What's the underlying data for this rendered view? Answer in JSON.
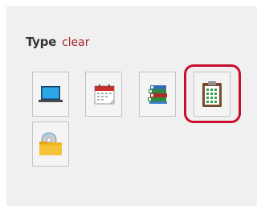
{
  "filter": {
    "label": "Type",
    "clear_label": "clear"
  },
  "tiles": [
    {
      "name": "laptop-icon",
      "selected": false
    },
    {
      "name": "calendar-icon",
      "selected": false
    },
    {
      "name": "books-icon",
      "selected": false
    },
    {
      "name": "clipboard-spreadsheet-icon",
      "selected": true
    },
    {
      "name": "folder-disc-icon",
      "selected": false
    }
  ],
  "colors": {
    "clear_link": "#a42323",
    "selection_ring": "#c8102e"
  }
}
